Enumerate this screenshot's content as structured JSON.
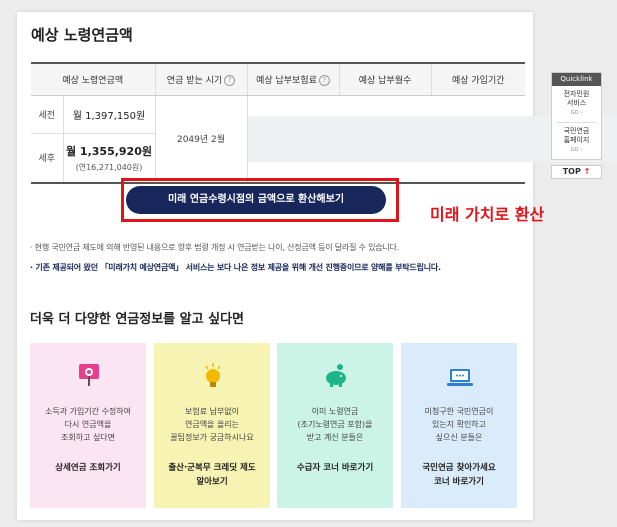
{
  "section_title": "예상 노령연금액",
  "table": {
    "headers": [
      "예상 노령연금액",
      "연금 받는 시기",
      "예상 납부보험료",
      "예상 납부월수",
      "예상 가입기간"
    ],
    "rows": {
      "pre_tax_label": "세전",
      "pre_tax_amount": "월 1,397,150원",
      "post_tax_label": "세후",
      "post_tax_amount": "월 1,355,920원",
      "post_tax_annual": "(연16,271,040원)",
      "receive_time": "2049년 2월"
    }
  },
  "cta": {
    "button_label": "미래 연금수령시점의 금액으로 환산해보기",
    "annotation": "미래 가치로 환산"
  },
  "notices": [
    "· 현행 국민연금 제도에 의해 반영된 내용으로 향후 법령 개정 시 연금받는 나이, 산정금액 등이 달라질 수 있습니다.",
    "· 기존 제공되어 왔던 「미래가치 예상연금액」 서비스는 보다 나은 정보 제공을 위해 개선 진행중이므로 양해를 부탁드립니다."
  ],
  "more_title": "더욱 더 다양한 연금정보를 알고 싶다면",
  "cards": [
    {
      "desc": "소득과 가입기간 수정하여\n다시 연금액을\n조회하고 싶다면",
      "link": "상세연금 조회가기",
      "icon": "monitor-pin-icon"
    },
    {
      "desc": "보험료 납부없이\n연금액을 올리는\n꿀팁정보가 궁금하시나요",
      "link": "출산·군복무 크레딧 제도\n알아보기",
      "icon": "lightbulb-icon"
    },
    {
      "desc": "이미 노령연금\n(조기노령연금 포함)을\n받고 계신 분들은",
      "link": "수급자 코너 바로가기",
      "icon": "piggy-bank-icon"
    },
    {
      "desc": "미청구한 국민연금이\n있는지 확인하고\n싶으신 분들은",
      "link": "국민연금 찾아가세요\n코너 바로가기",
      "icon": "laptop-icon"
    }
  ],
  "quicklink": {
    "title": "Quicklink",
    "items": [
      {
        "label": "전자민원\n서비스",
        "go": "GO"
      },
      {
        "label": "국민연금\n홈페이지",
        "go": "GO"
      }
    ],
    "top_label": "TOP",
    "top_arrow": "↑"
  },
  "help_mark": "?",
  "colors": {
    "navy": "#17265b",
    "red": "#e2141b"
  }
}
